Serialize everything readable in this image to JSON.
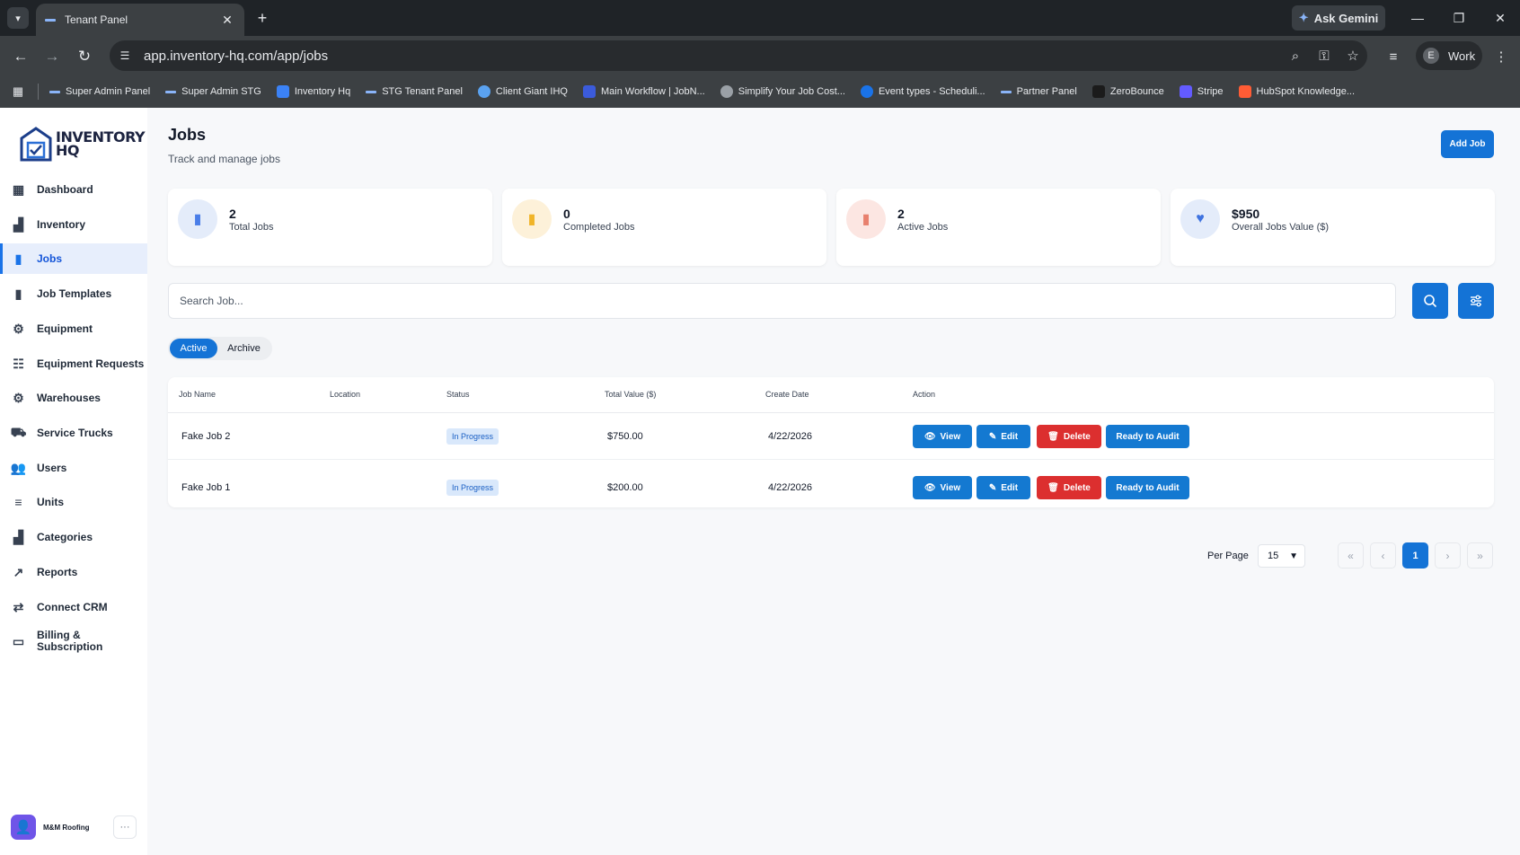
{
  "browser": {
    "tab_title": "Tenant Panel",
    "url": "app.inventory-hq.com/app/jobs",
    "ask_gemini": "Ask Gemini",
    "profile_initial": "E",
    "profile_label": "Work",
    "bookmarks": [
      {
        "label": "Super Admin Panel",
        "icon": "dash"
      },
      {
        "label": "Super Admin STG",
        "icon": "dash"
      },
      {
        "label": "Inventory Hq",
        "icon": "house",
        "color": "#3b82f6"
      },
      {
        "label": "STG Tenant Panel",
        "icon": "dash"
      },
      {
        "label": "Client Giant IHQ",
        "icon": "circle",
        "color": "#5aa2f0"
      },
      {
        "label": "Main Workflow | JobN...",
        "icon": "square",
        "color": "#3b5bdb"
      },
      {
        "label": "Simplify Your Job Cost...",
        "icon": "globe",
        "color": "#9aa0a6"
      },
      {
        "label": "Event types - Scheduli...",
        "icon": "circle",
        "color": "#1a73e8"
      },
      {
        "label": "Partner Panel",
        "icon": "dash"
      },
      {
        "label": "ZeroBounce",
        "icon": "square",
        "color": "#1b1b1b"
      },
      {
        "label": "Stripe",
        "icon": "square",
        "color": "#635bff"
      },
      {
        "label": "HubSpot Knowledge...",
        "icon": "square",
        "color": "#ff5c35"
      }
    ]
  },
  "brand": {
    "line1": "INVENTORY",
    "line2": "HQ"
  },
  "sidebar": {
    "items": [
      {
        "label": "Dashboard",
        "icon": "grid-icon",
        "glyph": "▦",
        "active": false
      },
      {
        "label": "Inventory",
        "icon": "boxes-icon",
        "glyph": "▟",
        "active": false
      },
      {
        "label": "Jobs",
        "icon": "briefcase-icon",
        "glyph": "▮",
        "active": true
      },
      {
        "label": "Job Templates",
        "icon": "briefcase-icon",
        "glyph": "▮",
        "active": false
      },
      {
        "label": "Equipment",
        "icon": "gear-icon",
        "glyph": "⚙",
        "active": false
      },
      {
        "label": "Equipment Requests",
        "icon": "list-icon",
        "glyph": "☷",
        "active": false
      },
      {
        "label": "Warehouses",
        "icon": "gear-icon",
        "glyph": "⚙",
        "active": false
      },
      {
        "label": "Service Trucks",
        "icon": "truck-icon",
        "glyph": "⛟",
        "active": false
      },
      {
        "label": "Users",
        "icon": "users-icon",
        "glyph": "👥",
        "active": false
      },
      {
        "label": "Units",
        "icon": "units-icon",
        "glyph": "≡",
        "active": false
      },
      {
        "label": "Categories",
        "icon": "boxes-icon",
        "glyph": "▟",
        "active": false
      },
      {
        "label": "Reports",
        "icon": "chart-icon",
        "glyph": "↗",
        "active": false
      },
      {
        "label": "Connect CRM",
        "icon": "connect-icon",
        "glyph": "⇄",
        "active": false
      },
      {
        "label": "Billing &",
        "label2": "Subscription",
        "icon": "card-icon",
        "glyph": "▭",
        "active": false
      }
    ],
    "user_name": "M&M Roofing",
    "user_more": "···"
  },
  "header": {
    "title": "Jobs",
    "subtitle": "Track and manage jobs",
    "add_button": "Add Job"
  },
  "stats": [
    {
      "value": "2",
      "label": "Total Jobs",
      "icon": "briefcase-icon",
      "bg": "#e4ecfa",
      "fg": "#4a7ee8"
    },
    {
      "value": "0",
      "label": "Completed Jobs",
      "icon": "briefcase-icon",
      "bg": "#fdf1d9",
      "fg": "#f0b429"
    },
    {
      "value": "2",
      "label": "Active Jobs",
      "icon": "briefcase-icon",
      "bg": "#fce6e2",
      "fg": "#e8806e"
    },
    {
      "value": "$950",
      "label": "Overall Jobs Value ($)",
      "icon": "heart-icon",
      "bg": "#e4ecfa",
      "fg": "#3f73e0"
    }
  ],
  "search": {
    "placeholder": "Search Job..."
  },
  "filter_tabs": {
    "active": "Active",
    "archive": "Archive"
  },
  "table": {
    "headers": [
      "Job Name",
      "Location",
      "Status",
      "Total Value ($)",
      "Create Date",
      "Action"
    ],
    "rows": [
      {
        "name": "Fake Job 2",
        "location": "",
        "status": "In Progress",
        "value": "$750.00",
        "date": "4/22/2026"
      },
      {
        "name": "Fake Job 1",
        "location": "",
        "status": "In Progress",
        "value": "$200.00",
        "date": "4/22/2026"
      }
    ],
    "actions": {
      "view": "View",
      "edit": "Edit",
      "delete": "Delete",
      "audit": "Ready to Audit"
    }
  },
  "pagination": {
    "per_page_label": "Per Page",
    "per_page_value": "15",
    "first": "«",
    "prev": "‹",
    "current": "1",
    "next": "›",
    "last": "»"
  },
  "colors": {
    "accent": "#1473d6",
    "danger": "#dc2f2f",
    "active_nav_bg": "#e7eefc"
  }
}
